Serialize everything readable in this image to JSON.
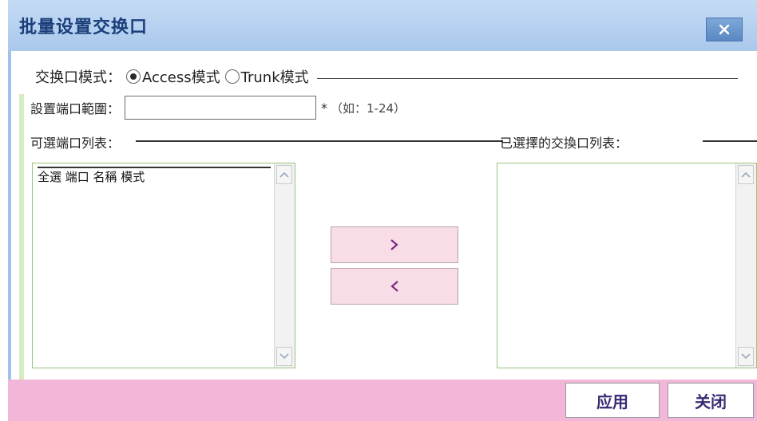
{
  "dialog": {
    "title": "批量设置交换口",
    "close_label": "×"
  },
  "mode": {
    "label": "交换口模式：",
    "options": [
      {
        "label": "Access模式",
        "checked": true
      },
      {
        "label": "Trunk模式",
        "checked": false
      }
    ]
  },
  "port": {
    "label": "設置端口範圍：",
    "value": "",
    "required_mark": "*",
    "hint": "（如：1-24）"
  },
  "lists": {
    "left_title": "可選端口列表：",
    "right_title": "已選擇的交換口列表：",
    "left_items": [
      "全選 端口 名稱 模式"
    ],
    "right_items": []
  },
  "transfer": {
    "add_label": ">",
    "remove_label": "<"
  },
  "footer": {
    "apply_label": "应用",
    "close_label": "关闭"
  },
  "colors": {
    "titlebar": "#b8d2f0",
    "footer": "#f2b7d8",
    "move_button": "#f9dde6",
    "list_border": "#99c47a"
  }
}
